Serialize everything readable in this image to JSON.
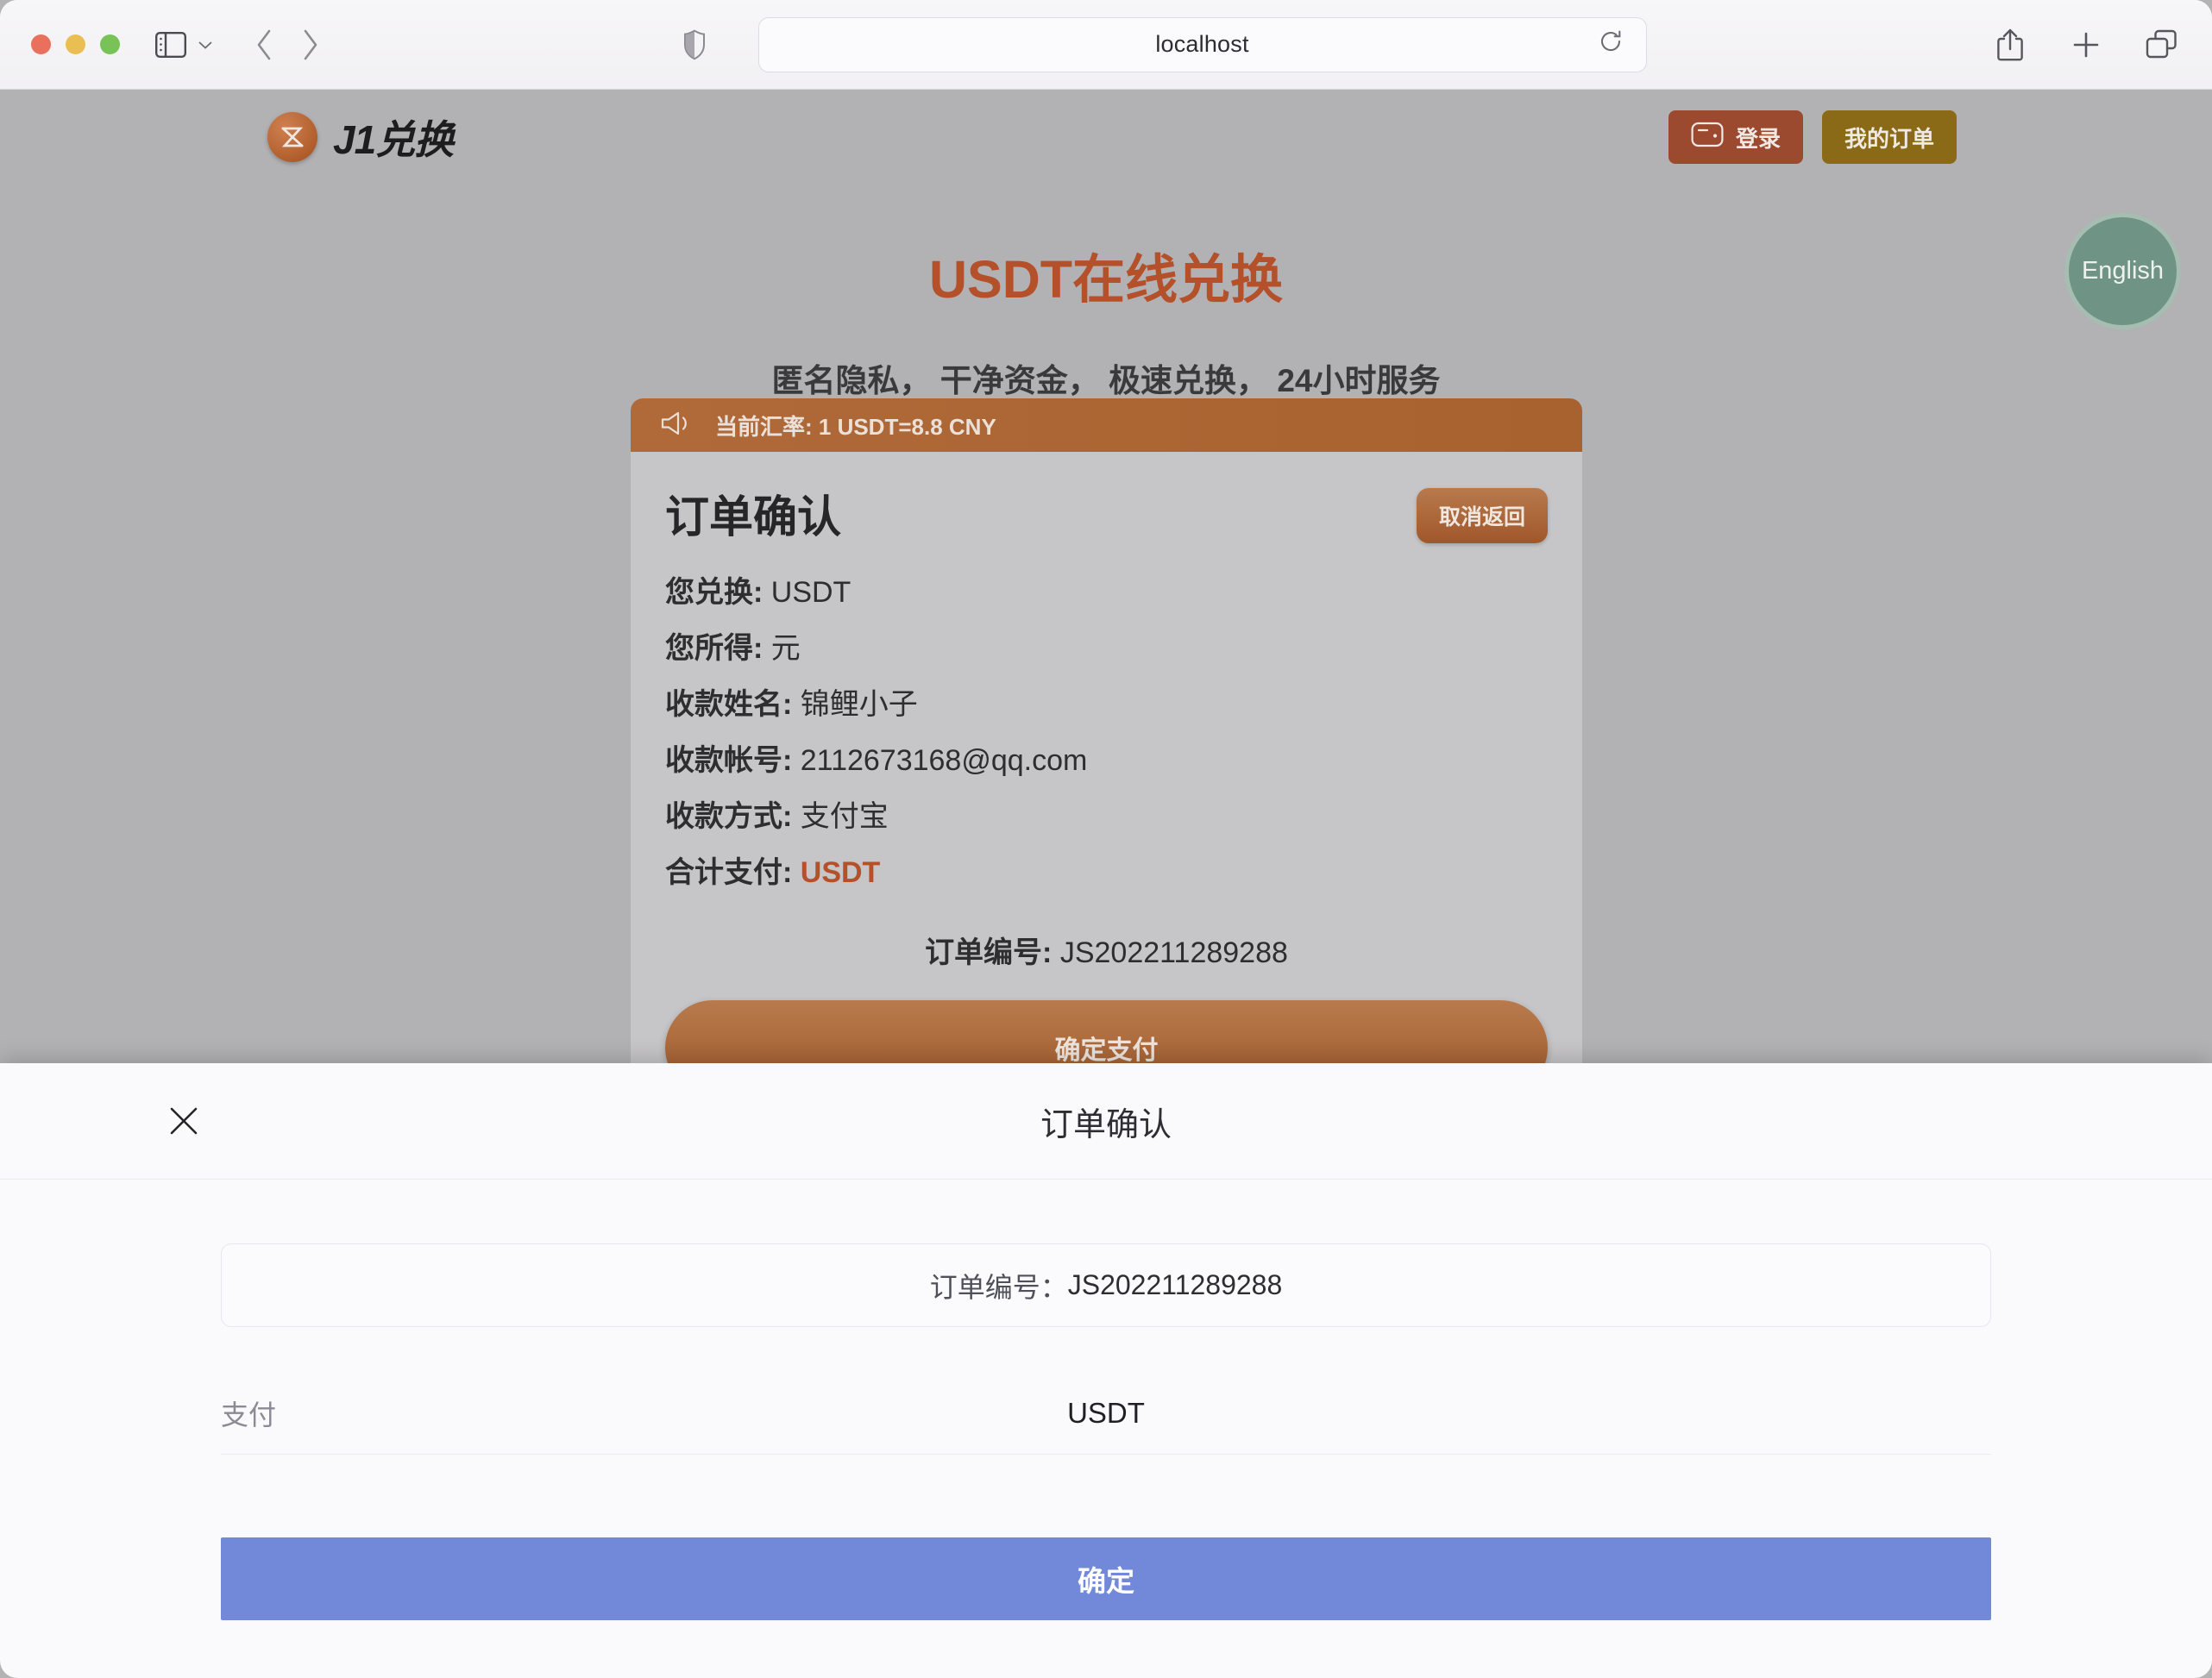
{
  "browser": {
    "url_value": "localhost",
    "icons": {
      "sidebar": "sidebar-icon",
      "sidebar_chevron": "chevron-down-icon",
      "back": "back-arrow-icon",
      "forward": "forward-arrow-icon",
      "shield": "shield-icon",
      "reload": "reload-icon",
      "share": "share-icon",
      "new_tab": "plus-icon",
      "tabs": "tab-overview-icon"
    }
  },
  "site": {
    "logo_text": "J1兑换",
    "logo_icon": "j1-logo-mark",
    "login_label": "登录",
    "login_icon": "wallet-icon",
    "orders_label": "我的订单",
    "language_label": "English",
    "hero_title": "USDT在线兑换",
    "hero_subtitle": "匿名隐私， 干净资金， 极速兑换， 24小时服务",
    "colors": {
      "accent": "#b4502a",
      "login_bg": "#9b4a30",
      "orders_bg": "#8a6a16",
      "rate_bar": "#a8622f",
      "lang_bg": "#6f9384",
      "confirm_blue": "#7289da"
    }
  },
  "card": {
    "rate_icon": "megaphone-icon",
    "rate_text": "当前汇率: 1 USDT=8.8 CNY",
    "title": "订单确认",
    "cancel_label": "取消返回",
    "details": [
      {
        "label": "您兑换:",
        "value": "USDT",
        "accent": false
      },
      {
        "label": "您所得:",
        "value": "元",
        "accent": false
      },
      {
        "label": "收款姓名:",
        "value": "锦鲤小子",
        "accent": false
      },
      {
        "label": "收款帐号:",
        "value": "2112673168@qq.com",
        "accent": false
      },
      {
        "label": "收款方式:",
        "value": "支付宝",
        "accent": false
      },
      {
        "label": "合计支付:",
        "value": "USDT",
        "accent": true
      }
    ],
    "order_label": "订单编号:",
    "order_number": "JS202211289288",
    "pay_label": "确定支付"
  },
  "sheet": {
    "close_icon": "close-icon",
    "title": "订单确认",
    "order_label": "订单编号：",
    "order_number": "JS202211289288",
    "pay_row_label": "支付",
    "pay_row_value": "USDT",
    "confirm_label": "确定"
  }
}
